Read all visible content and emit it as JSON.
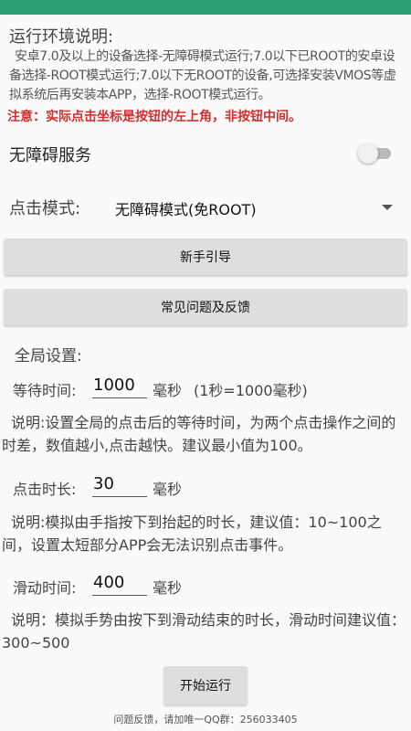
{
  "colors": {
    "status_bar": "#2e9e73",
    "note": "#d32f2f",
    "button_bg": "#dedede"
  },
  "env": {
    "title": "运行环境说明:",
    "description": "安卓7.0及以上的设备选择-无障碍模式运行;7.0以下已ROOT的安卓设备选择-ROOT模式运行;7.0以下无ROOT的设备,可选择安装VMOS等虚拟系统后再安装本APP，选择-ROOT模式运行。",
    "note": "注意：实际点击坐标是按钮的左上角，非按钮中间。"
  },
  "accessibility": {
    "label": "无障碍服务",
    "enabled": false
  },
  "click_mode": {
    "label": "点击模式:",
    "selected": "无障碍模式(免ROOT)"
  },
  "buttons": {
    "guide": "新手引导",
    "faq": "常见问题及反馈",
    "start": "开始运行"
  },
  "global": {
    "title": "全局设置:",
    "wait": {
      "label": "等待时间:",
      "value": "1000",
      "unit": "毫秒",
      "hint": "(1秒=1000毫秒)",
      "desc": "说明:设置全局的点击后的等待时间，为两个点击操作之间的时差，数值越小,点击越快。建议最小值为100。"
    },
    "click_duration": {
      "label": "点击时长:",
      "value": "30",
      "unit": "毫秒",
      "desc": "说明:模拟由手指按下到抬起的时长，建议值：10~100之间，设置太短部分APP会无法识别点击事件。"
    },
    "swipe_duration": {
      "label": "滑动时间:",
      "value": "400",
      "unit": "毫秒",
      "desc": "说明：模拟手势由按下到滑动结束的时长，滑动时间建议值：300~500"
    }
  },
  "footer": "问题反馈，请加唯一QQ群：256033405"
}
